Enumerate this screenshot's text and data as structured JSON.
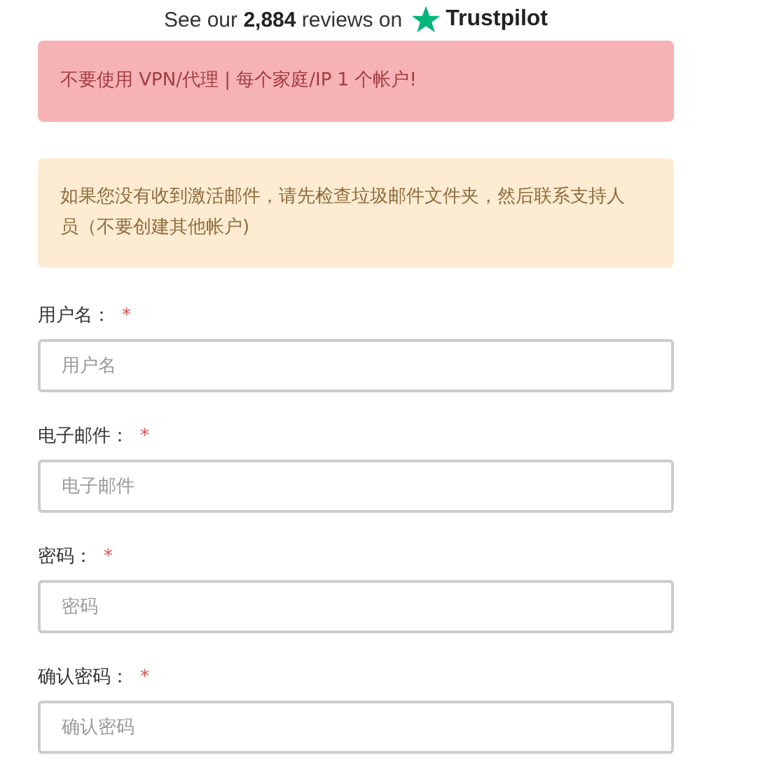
{
  "reviews": {
    "text": "See our **2,884** reviews on",
    "brand": "Trustpilot"
  },
  "alerts": [
    {
      "kind": "danger",
      "text": "不要使用 VPN/代理 | 每个家庭/IP 1 个帐户!"
    },
    {
      "kind": "warning",
      "text": "如果您没有收到激活邮件，请先检查垃圾邮件文件夹，然后联系支持人员（不要创建其他帐户)"
    }
  ],
  "fields": [
    {
      "label": "用户名：",
      "required_mark": "*",
      "placeholder": "用户名"
    },
    {
      "label": "电子邮件：",
      "required_mark": "*",
      "placeholder": "电子邮件"
    },
    {
      "label": "密码：",
      "required_mark": "*",
      "placeholder": "密码"
    },
    {
      "label": "确认密码：",
      "required_mark": "*",
      "placeholder": "确认密码"
    }
  ]
}
